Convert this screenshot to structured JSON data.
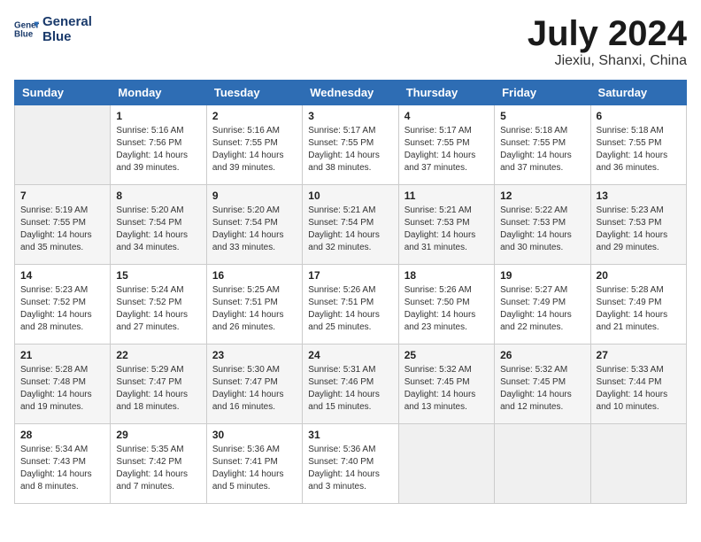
{
  "logo": {
    "line1": "General",
    "line2": "Blue"
  },
  "title": "July 2024",
  "location": "Jiexiu, Shanxi, China",
  "days_of_week": [
    "Sunday",
    "Monday",
    "Tuesday",
    "Wednesday",
    "Thursday",
    "Friday",
    "Saturday"
  ],
  "weeks": [
    [
      {
        "day": "",
        "info": ""
      },
      {
        "day": "1",
        "info": "Sunrise: 5:16 AM\nSunset: 7:56 PM\nDaylight: 14 hours\nand 39 minutes."
      },
      {
        "day": "2",
        "info": "Sunrise: 5:16 AM\nSunset: 7:55 PM\nDaylight: 14 hours\nand 39 minutes."
      },
      {
        "day": "3",
        "info": "Sunrise: 5:17 AM\nSunset: 7:55 PM\nDaylight: 14 hours\nand 38 minutes."
      },
      {
        "day": "4",
        "info": "Sunrise: 5:17 AM\nSunset: 7:55 PM\nDaylight: 14 hours\nand 37 minutes."
      },
      {
        "day": "5",
        "info": "Sunrise: 5:18 AM\nSunset: 7:55 PM\nDaylight: 14 hours\nand 37 minutes."
      },
      {
        "day": "6",
        "info": "Sunrise: 5:18 AM\nSunset: 7:55 PM\nDaylight: 14 hours\nand 36 minutes."
      }
    ],
    [
      {
        "day": "7",
        "info": "Sunrise: 5:19 AM\nSunset: 7:55 PM\nDaylight: 14 hours\nand 35 minutes."
      },
      {
        "day": "8",
        "info": "Sunrise: 5:20 AM\nSunset: 7:54 PM\nDaylight: 14 hours\nand 34 minutes."
      },
      {
        "day": "9",
        "info": "Sunrise: 5:20 AM\nSunset: 7:54 PM\nDaylight: 14 hours\nand 33 minutes."
      },
      {
        "day": "10",
        "info": "Sunrise: 5:21 AM\nSunset: 7:54 PM\nDaylight: 14 hours\nand 32 minutes."
      },
      {
        "day": "11",
        "info": "Sunrise: 5:21 AM\nSunset: 7:53 PM\nDaylight: 14 hours\nand 31 minutes."
      },
      {
        "day": "12",
        "info": "Sunrise: 5:22 AM\nSunset: 7:53 PM\nDaylight: 14 hours\nand 30 minutes."
      },
      {
        "day": "13",
        "info": "Sunrise: 5:23 AM\nSunset: 7:53 PM\nDaylight: 14 hours\nand 29 minutes."
      }
    ],
    [
      {
        "day": "14",
        "info": "Sunrise: 5:23 AM\nSunset: 7:52 PM\nDaylight: 14 hours\nand 28 minutes."
      },
      {
        "day": "15",
        "info": "Sunrise: 5:24 AM\nSunset: 7:52 PM\nDaylight: 14 hours\nand 27 minutes."
      },
      {
        "day": "16",
        "info": "Sunrise: 5:25 AM\nSunset: 7:51 PM\nDaylight: 14 hours\nand 26 minutes."
      },
      {
        "day": "17",
        "info": "Sunrise: 5:26 AM\nSunset: 7:51 PM\nDaylight: 14 hours\nand 25 minutes."
      },
      {
        "day": "18",
        "info": "Sunrise: 5:26 AM\nSunset: 7:50 PM\nDaylight: 14 hours\nand 23 minutes."
      },
      {
        "day": "19",
        "info": "Sunrise: 5:27 AM\nSunset: 7:49 PM\nDaylight: 14 hours\nand 22 minutes."
      },
      {
        "day": "20",
        "info": "Sunrise: 5:28 AM\nSunset: 7:49 PM\nDaylight: 14 hours\nand 21 minutes."
      }
    ],
    [
      {
        "day": "21",
        "info": "Sunrise: 5:28 AM\nSunset: 7:48 PM\nDaylight: 14 hours\nand 19 minutes."
      },
      {
        "day": "22",
        "info": "Sunrise: 5:29 AM\nSunset: 7:47 PM\nDaylight: 14 hours\nand 18 minutes."
      },
      {
        "day": "23",
        "info": "Sunrise: 5:30 AM\nSunset: 7:47 PM\nDaylight: 14 hours\nand 16 minutes."
      },
      {
        "day": "24",
        "info": "Sunrise: 5:31 AM\nSunset: 7:46 PM\nDaylight: 14 hours\nand 15 minutes."
      },
      {
        "day": "25",
        "info": "Sunrise: 5:32 AM\nSunset: 7:45 PM\nDaylight: 14 hours\nand 13 minutes."
      },
      {
        "day": "26",
        "info": "Sunrise: 5:32 AM\nSunset: 7:45 PM\nDaylight: 14 hours\nand 12 minutes."
      },
      {
        "day": "27",
        "info": "Sunrise: 5:33 AM\nSunset: 7:44 PM\nDaylight: 14 hours\nand 10 minutes."
      }
    ],
    [
      {
        "day": "28",
        "info": "Sunrise: 5:34 AM\nSunset: 7:43 PM\nDaylight: 14 hours\nand 8 minutes."
      },
      {
        "day": "29",
        "info": "Sunrise: 5:35 AM\nSunset: 7:42 PM\nDaylight: 14 hours\nand 7 minutes."
      },
      {
        "day": "30",
        "info": "Sunrise: 5:36 AM\nSunset: 7:41 PM\nDaylight: 14 hours\nand 5 minutes."
      },
      {
        "day": "31",
        "info": "Sunrise: 5:36 AM\nSunset: 7:40 PM\nDaylight: 14 hours\nand 3 minutes."
      },
      {
        "day": "",
        "info": ""
      },
      {
        "day": "",
        "info": ""
      },
      {
        "day": "",
        "info": ""
      }
    ]
  ]
}
